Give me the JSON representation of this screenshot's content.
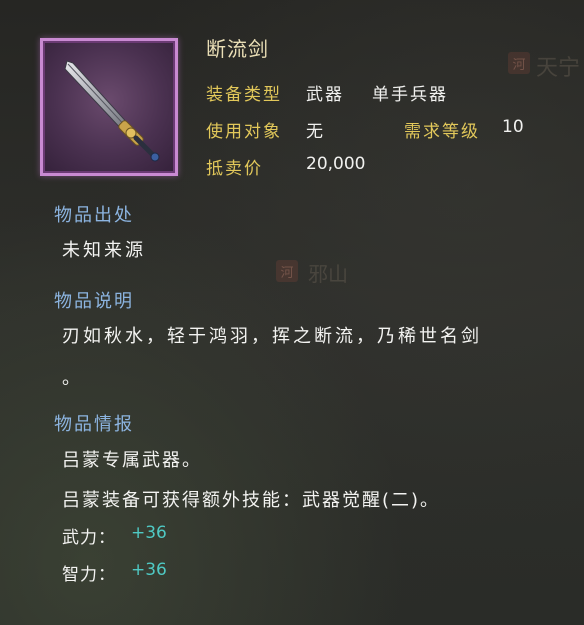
{
  "background": {
    "map_labels": [
      "天宁",
      "邪山"
    ],
    "map_seals": [
      "河",
      "河"
    ]
  },
  "item": {
    "name": "断流剑",
    "icon": "sword-icon",
    "frame_color": "#c98ad2",
    "equip_type_label": "装备类型",
    "equip_type_value": "武器",
    "equip_subtype_value": "单手兵器",
    "user_label": "使用对象",
    "user_value": "无",
    "level_req_label": "需求等级",
    "level_req_value": "10",
    "price_label": "抵卖价",
    "price_value": "20,000"
  },
  "origin": {
    "header": "物品出处",
    "text": "未知来源"
  },
  "description": {
    "header": "物品说明",
    "line1": "刃如秋水，轻于鸿羽，挥之断流，乃稀世名剑",
    "line2": "。"
  },
  "intel": {
    "header": "物品情报",
    "line1": "吕蒙专属武器。",
    "line2": "吕蒙装备可获得额外技能：武器觉醒(二)。",
    "stats": [
      {
        "label": "武力：",
        "value": "+36"
      },
      {
        "label": "智力：",
        "value": "+36"
      }
    ]
  },
  "colors": {
    "label_gold": "#e2c85a",
    "section_blue": "#8cb4e0",
    "stat_teal": "#4fc9c4"
  }
}
